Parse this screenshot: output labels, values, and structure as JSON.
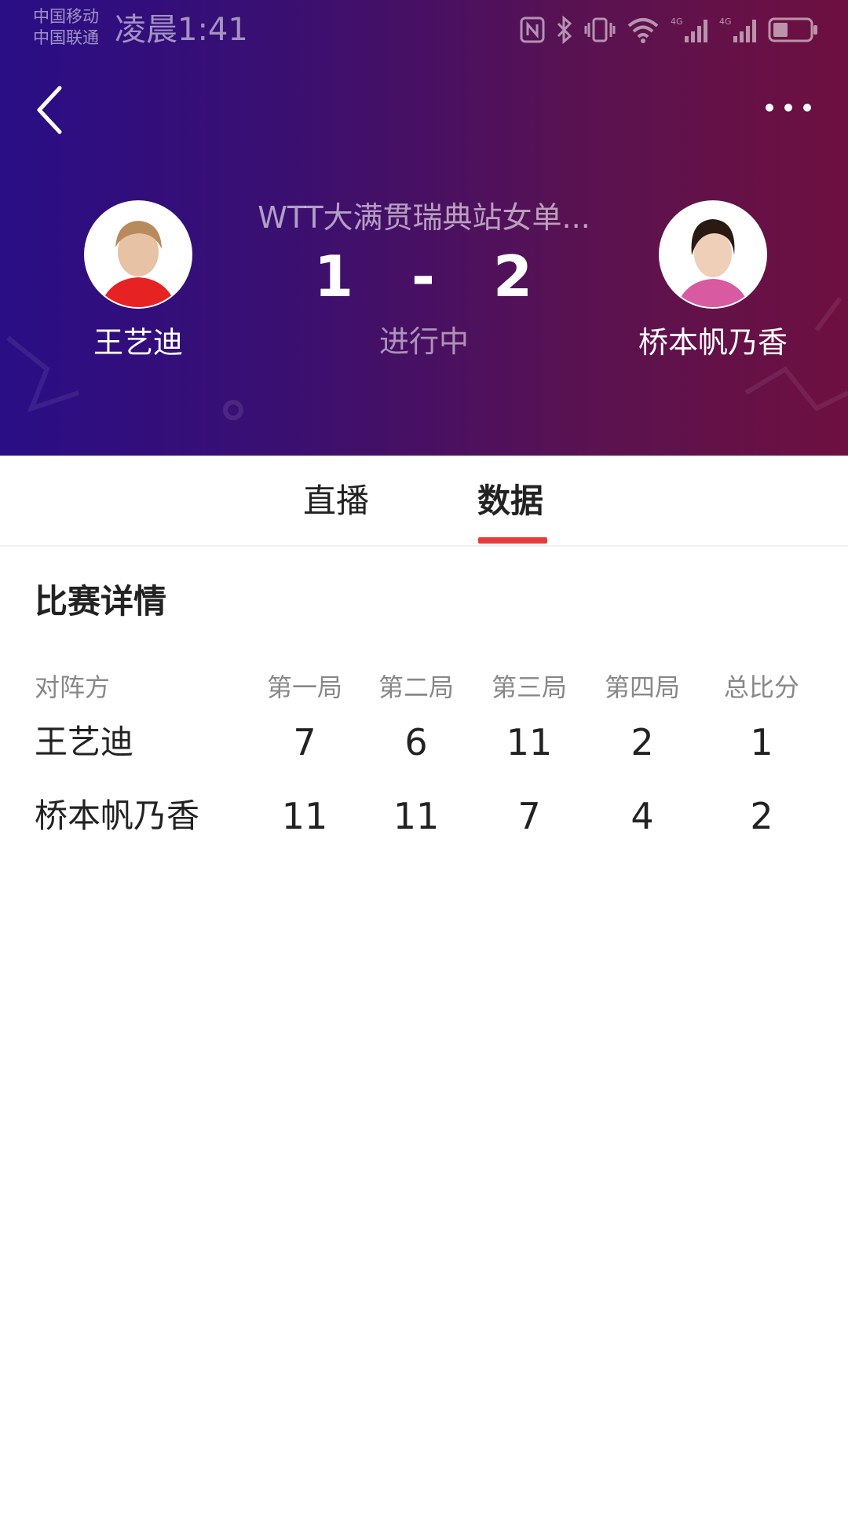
{
  "status_bar": {
    "carrier_1": "中国移动",
    "carrier_2": "中国联通",
    "time": "凌晨1:41",
    "icons": [
      "nfc-icon",
      "bluetooth-icon",
      "vibrate-icon",
      "wifi-icon",
      "signal-4g-icon",
      "signal-4g-icon",
      "battery-icon"
    ]
  },
  "header": {
    "match_title": "WTT大满贯瑞典站女单...",
    "score_left": "1",
    "score_dash": "-",
    "score_right": "2",
    "status": "进行中",
    "player_left": {
      "name": "王艺迪"
    },
    "player_right": {
      "name": "桥本帆乃香"
    },
    "colors": {
      "gradient_start": "#2a0e86",
      "gradient_end": "#6e1040"
    }
  },
  "tabs": [
    {
      "label": "直播",
      "active": false
    },
    {
      "label": "数据",
      "active": true
    }
  ],
  "accent_color": "#e63b3b",
  "details": {
    "title": "比赛详情",
    "columns": [
      "对阵方",
      "第一局",
      "第二局",
      "第三局",
      "第四局",
      "总比分"
    ],
    "rows": [
      {
        "name": "王艺迪",
        "g1": "7",
        "g2": "6",
        "g3": "11",
        "g4": "2",
        "total": "1"
      },
      {
        "name": "桥本帆乃香",
        "g1": "11",
        "g2": "11",
        "g3": "7",
        "g4": "4",
        "total": "2"
      }
    ]
  }
}
